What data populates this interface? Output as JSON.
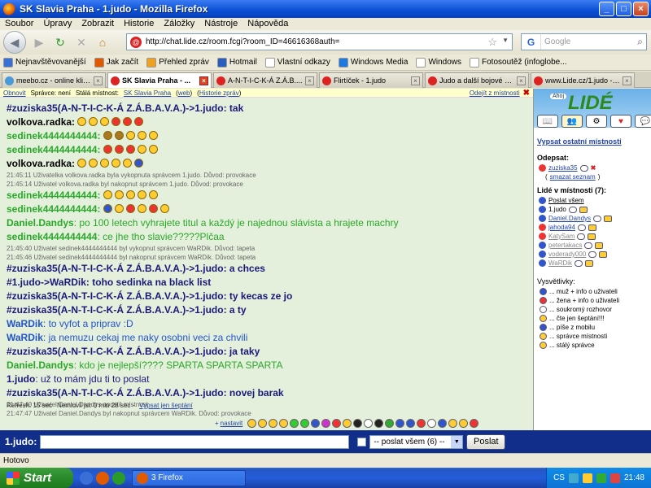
{
  "window": {
    "title": "SK Slavia Praha - 1.judo - Mozilla Firefox",
    "buttons": [
      "_",
      "□",
      "×"
    ]
  },
  "menu": [
    "Soubor",
    "Úpravy",
    "Zobrazit",
    "Historie",
    "Záložky",
    "Nástroje",
    "Nápověda"
  ],
  "nav": {
    "url": "http://chat.lide.cz/room.fcgi?room_ID=46616368auth=",
    "search_placeholder": "Google",
    "search_engine_icon": "G"
  },
  "bookmarks": [
    {
      "label": "Nejnavštěvovanější",
      "color": "#3a6fd8"
    },
    {
      "label": "Jak začít",
      "color": "#e25a00"
    },
    {
      "label": "Přehled zpráv",
      "color": "#f0a020"
    },
    {
      "label": "Hotmail",
      "color": "#2a5cbe"
    },
    {
      "label": "Vlastní odkazy",
      "color": "#ffffff"
    },
    {
      "label": "Windows Media",
      "color": "#1e7ae0"
    },
    {
      "label": "Windows",
      "color": "#ffffff"
    },
    {
      "label": "Fotosoutěž (infoglobe...",
      "color": "#ffffff"
    }
  ],
  "tabs": [
    {
      "label": "meebo.cz - online klie...",
      "color": "#4a9ad8"
    },
    {
      "label": "SK Slavia Praha - ...",
      "color": "#d22",
      "active": true
    },
    {
      "label": "A-N-T-I-C-K-Á Z.Á.B....",
      "color": "#d22"
    },
    {
      "label": "Flirtíček - 1.judo",
      "color": "#d22"
    },
    {
      "label": "Judo a další bojové sp...",
      "color": "#d22"
    },
    {
      "label": "www.Lide.cz/1.judo - ...",
      "color": "#d22"
    }
  ],
  "infobar": {
    "obnovit": "Obnovit",
    "spravce": "Správce: není",
    "stala": "Stálá místnost:",
    "room": "SK Slavia Praha",
    "web": "web",
    "historie": "Historie zpráv",
    "odejit": "Odejít z místnosti"
  },
  "chat": [
    {
      "type": "msg",
      "nick": "#zuziska35(A-N-T-I-C-K-Á Z.Á.B.A.V.A.)->1.judo",
      "text": ": tak",
      "style": "dark"
    },
    {
      "type": "msg",
      "nick": "volkova.radka",
      "text": ":",
      "style": "black",
      "emoticons": [
        "#ffcc33",
        "#ffcc33",
        "#ffcc33",
        "#ee3333",
        "#ee3333",
        "#ee3333"
      ]
    },
    {
      "type": "msg",
      "nick": "sedinek4444444444",
      "text": ":",
      "style": "green",
      "emoticons": [
        "#aa7722",
        "#aa7722",
        "#ffcc33",
        "#ffcc33",
        "#ffcc33"
      ]
    },
    {
      "type": "msg",
      "nick": "sedinek4444444444",
      "text": ":",
      "style": "green",
      "emoticons": [
        "#ee3333",
        "#ee3333",
        "#ee3333",
        "#ffcc33",
        "#ffcc33"
      ]
    },
    {
      "type": "msg",
      "nick": "volkova.radka",
      "text": ":",
      "style": "black",
      "emoticons": [
        "#ffcc33",
        "#ffcc33",
        "#ffcc33",
        "#ffcc33",
        "#ffcc33",
        "#3355cc"
      ]
    },
    {
      "type": "sys",
      "text": "21:45:11 Uživatelka volkova.radka byla vykopnuta správcem 1.judo. Důvod: provokace"
    },
    {
      "type": "sys",
      "text": "21:45:14 Uživatel volkova.radka byl nakopnut správcem 1.judo. Důvod: provokace"
    },
    {
      "type": "msg",
      "nick": "sedinek4444444444",
      "text": ":",
      "style": "green",
      "emoticons": [
        "#ffcc33",
        "#ffcc33",
        "#ffcc33",
        "#ffcc33",
        "#ffcc33"
      ]
    },
    {
      "type": "msg",
      "nick": "sedinek4444444444",
      "text": ":",
      "style": "green",
      "emoticons": [
        "#3355cc",
        "#ffcc33",
        "#ee3333",
        "#ffcc33",
        "#ee3333",
        "#ffcc33"
      ]
    },
    {
      "type": "msg",
      "nick": "Daniel.Dandys",
      "text": ": po 100 letech vyhrajete titul a každý je najednou slávista a hrajete machry",
      "style": "green",
      "normal": true
    },
    {
      "type": "msg",
      "nick": "sedinek4444444444",
      "text": ": ce jhe tho slavie?????Plčaa",
      "style": "green",
      "normal": true
    },
    {
      "type": "sys",
      "text": "21:45:40 Uživatel sedinek4444444444 byl vykopnut správcem WaRDik. Důvod: tapeta"
    },
    {
      "type": "sys",
      "text": "21:45:46 Uživatel sedinek4444444444 byl nakopnut správcem WaRDik. Důvod: tapeta"
    },
    {
      "type": "msg",
      "nick": "#zuziska35(A-N-T-I-C-K-Á Z.Á.B.A.V.A.)->1.judo",
      "text": ": a chces",
      "style": "dark"
    },
    {
      "type": "msg",
      "nick": "#1.judo->WaRDik",
      "text": ": toho sedinka na black list",
      "style": "dark"
    },
    {
      "type": "msg",
      "nick": "#zuziska35(A-N-T-I-C-K-Á Z.Á.B.A.V.A.)->1.judo",
      "text": ": ty kecas ze jo",
      "style": "dark"
    },
    {
      "type": "msg",
      "nick": "#zuziska35(A-N-T-I-C-K-Á Z.Á.B.A.V.A.)->1.judo",
      "text": ": a ty",
      "style": "dark"
    },
    {
      "type": "msg",
      "nick": "WaRDik",
      "text": ": to vyfot a priprav :D",
      "style": "blue",
      "normal": true
    },
    {
      "type": "msg",
      "nick": "WaRDik",
      "text": ": ja nemuzu cekaj me naky osobni veci za chvili",
      "style": "blue",
      "normal": true
    },
    {
      "type": "msg",
      "nick": "#zuziska35(A-N-T-I-C-K-Á Z.Á.B.A.V.A.)->1.judo",
      "text": ": ja taky",
      "style": "dark"
    },
    {
      "type": "msg",
      "nick": "Daniel.Dandys",
      "text": ": kdo je nejlepší???? SPARTA SPARTA SPARTA",
      "style": "green",
      "normal": true
    },
    {
      "type": "msg",
      "nick": "1.judo",
      "text": ": už to mám jdu ti to poslat",
      "style": "dark",
      "normal": true
    },
    {
      "type": "msg",
      "nick": "#zuziska35(A-N-T-I-C-K-Á Z.Á.B.A.V.A.)->1.judo",
      "text": ": novej barak",
      "style": "dark"
    },
    {
      "type": "sys",
      "text": "21:47:40 Uživatel Daniel.Dandys opustil místnost"
    },
    {
      "type": "sys",
      "text": "21:47:47 Uživatel Daniel.Dandys byl nakopnut správcem WaRDik. Důvod: provokace"
    }
  ],
  "footer": {
    "refresh": "Refresh: 15 sec",
    "nemluvil": "Nemluvil jsi: 0 min 28 sec -",
    "vypsat_septani": "Vypsat jen šeptání",
    "nastavit": "nastavit",
    "emoticon_colors": [
      "#ffcc33",
      "#ffcc33",
      "#ffcc33",
      "#ffcc33",
      "#33cc33",
      "#33cc33",
      "#3355cc",
      "#cc33cc",
      "#ee3333",
      "#ffcc33",
      "#222222",
      "#ffffff",
      "#222222",
      "#33aa33",
      "#3355cc",
      "#3355cc",
      "#ee3333",
      "#ffffff",
      "#3355cc",
      "#ffcc33",
      "#ffcc33",
      "#ee3333"
    ]
  },
  "input": {
    "label": "1.judo:",
    "select": "-- poslat všem (6) --",
    "send": "Poslat"
  },
  "status": "Hotovo",
  "sidebar": {
    "logo_ahoj": "Ahoj",
    "logo": "LIDÉ",
    "vypsat_ostatni": "Vypsat ostatní místnosti",
    "odepsat_label": "Odepsat:",
    "odepsat_user": "zuziska35",
    "smazat": "smazat seznam",
    "people_label": "Lidé v místnosti (7):",
    "poslat_vsem": "Poslat všem",
    "users": [
      {
        "name": "1.judo",
        "color": "#3355cc",
        "link": false
      },
      {
        "name": "Daniel.Dandys",
        "color": "#3355cc",
        "link": true
      },
      {
        "name": "jahoda94",
        "color": "#ee3333",
        "link": true
      },
      {
        "name": "KatySam",
        "color": "#ee3333",
        "link": true,
        "grey": true
      },
      {
        "name": "petertakacs",
        "color": "#3355cc",
        "link": true,
        "grey": true
      },
      {
        "name": "voderady000",
        "color": "#3355cc",
        "link": true,
        "grey": true
      },
      {
        "name": "WaRDik",
        "color": "#3355cc",
        "link": true,
        "grey": true
      }
    ],
    "legend_title": "Vysvětlivky:",
    "legend": [
      {
        "label": "... muž + info o uživateli",
        "color": "#3355cc"
      },
      {
        "label": "... žena + info o uživateli",
        "color": "#ee3333"
      },
      {
        "label": "... soukromý rozhovor",
        "color": "#ffffff"
      },
      {
        "label": "... čte jen šeptání!!!",
        "color": "#ffcc33"
      },
      {
        "label": "... píše z mobilu",
        "color": "#3355cc"
      },
      {
        "label": "... správce místnosti",
        "color": "#ffcc33"
      },
      {
        "label": "... stálý správce",
        "color": "#ffcc33"
      }
    ]
  },
  "taskbar": {
    "start": "Start",
    "task": "3 Firefox",
    "lang": "CS",
    "clock": "21:48"
  }
}
